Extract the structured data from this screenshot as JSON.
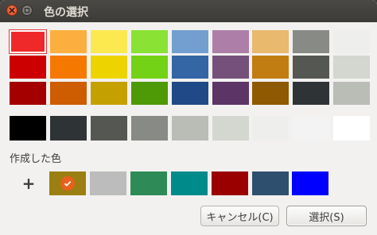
{
  "window": {
    "title": "色の選択"
  },
  "palette": {
    "rows": [
      [
        "#ef2929",
        "#fcaf3e",
        "#fce94f",
        "#8ae234",
        "#729fcf",
        "#ad7fa8",
        "#e9b96e",
        "#888a85",
        "#eeeeec"
      ],
      [
        "#cc0000",
        "#f57900",
        "#edd400",
        "#73d216",
        "#3465a4",
        "#75507b",
        "#c17d11",
        "#555753",
        "#d3d7cf"
      ],
      [
        "#a40000",
        "#ce5c00",
        "#c4a000",
        "#4e9a06",
        "#204a87",
        "#5c3566",
        "#8f5902",
        "#2e3436",
        "#babdb6"
      ]
    ],
    "grays": [
      "#000000",
      "#2e3436",
      "#555753",
      "#888a85",
      "#babdb6",
      "#d3d7cf",
      "#eeeeec",
      "#f3f3f3",
      "#ffffff"
    ],
    "selected": "#ef2929"
  },
  "custom": {
    "label": "作成した色",
    "add_glyph": "+",
    "colors": [
      "#9b7f12",
      "#bcbcbc",
      "#2e8b57",
      "#008b8b",
      "#9b0000",
      "#2f4f6f",
      "#0000ff"
    ],
    "selected_index": 0,
    "check_icon": "checkmark-icon"
  },
  "buttons": {
    "cancel": "キャンセル(C)",
    "select": "選択(S)"
  }
}
